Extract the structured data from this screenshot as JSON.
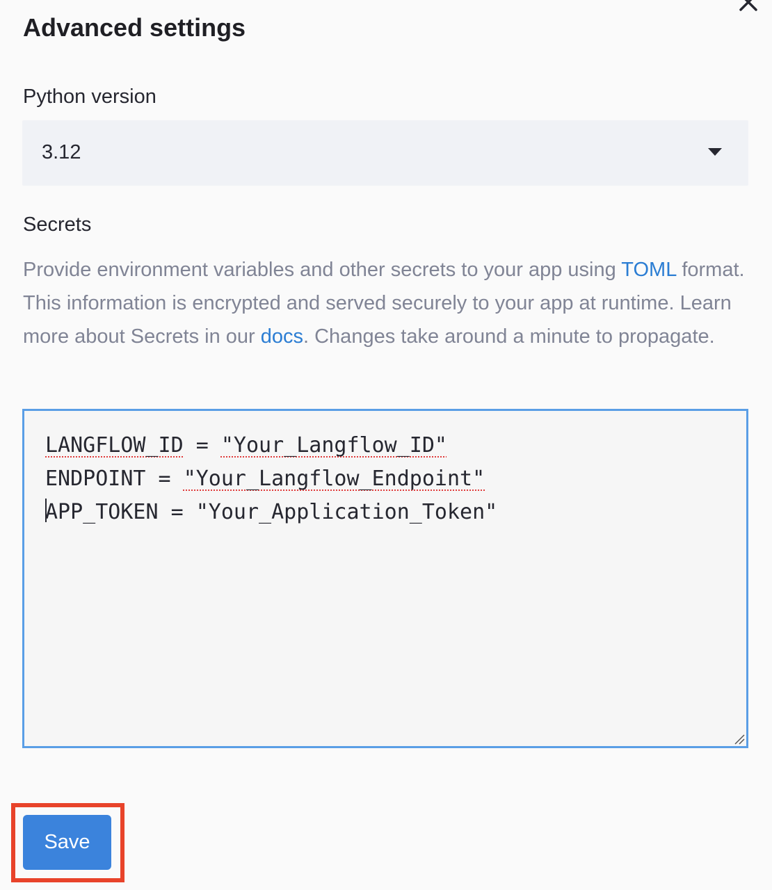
{
  "dialog": {
    "title": "Advanced settings",
    "close_icon": "close-icon"
  },
  "python": {
    "label": "Python version",
    "selected": "3.12",
    "caret_icon": "caret-down-icon"
  },
  "secrets": {
    "label": "Secrets",
    "description": {
      "part1": "Provide environment variables and other secrets to your app using ",
      "toml_link": "TOML",
      "part2": " format. This information is encrypted and served securely to your app at runtime. Learn more about Secrets in our ",
      "docs_link": "docs",
      "part3": ". Changes take around a minute to propagate."
    },
    "lines": [
      {
        "key": "LANGFLOW_ID",
        "sep": " = ",
        "value": "\"Your_Langflow_ID\""
      },
      {
        "key": "ENDPOINT",
        "sep": " = ",
        "value": "\"Your_Langflow_Endpoint\""
      },
      {
        "key": "APP_TOKEN",
        "sep": " = ",
        "value": "\"Your_Application_Token\""
      }
    ],
    "resize_icon": "resize-handle-icon"
  },
  "actions": {
    "save_label": "Save",
    "highlight_color": "#e8432a",
    "button_color": "#3b83dc"
  },
  "colors": {
    "link": "#2b7dd3",
    "focus_border": "#5a9ee6",
    "muted_text": "#808495"
  }
}
